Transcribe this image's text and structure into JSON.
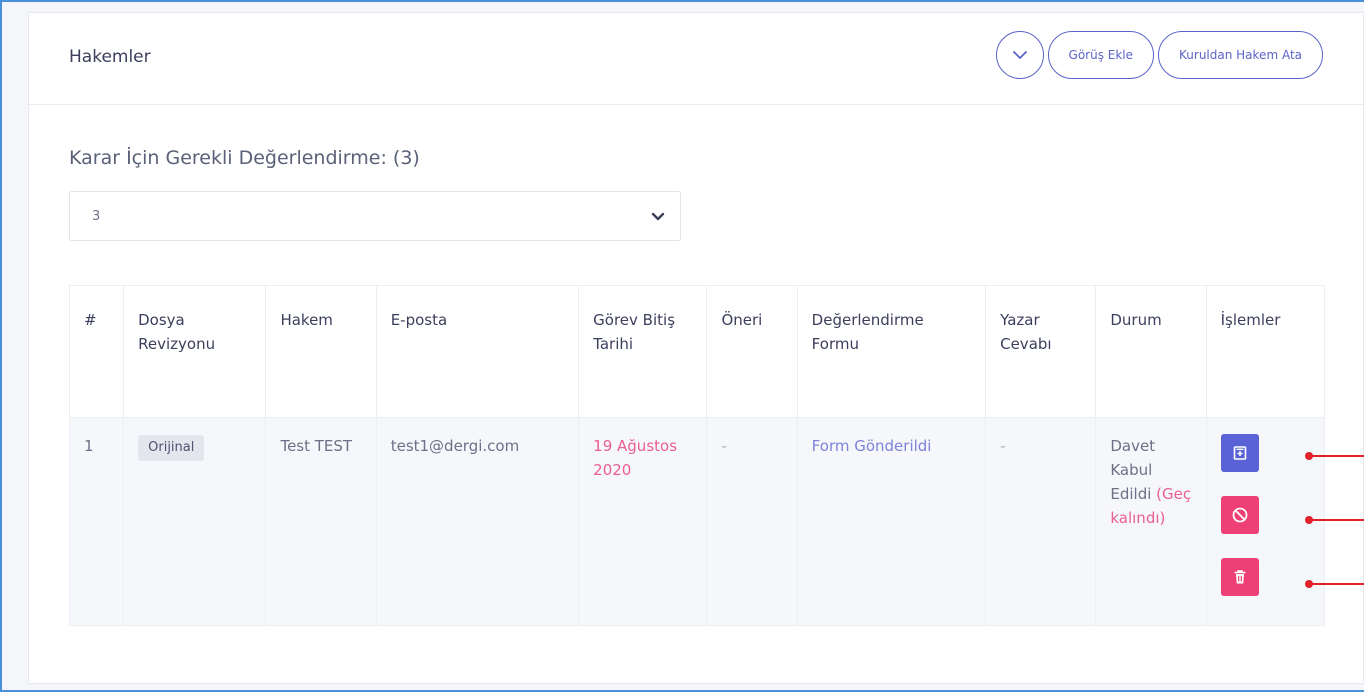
{
  "header": {
    "title": "Hakemler",
    "add_opinion": "Görüş Ekle",
    "assign_reviewer": "Kuruldan Hakem Ata"
  },
  "requirement": {
    "label": "Karar İçin Gerekli Değerlendirme: (3)",
    "selected": "3"
  },
  "table": {
    "columns": [
      "#",
      "Dosya Revizyonu",
      "Hakem",
      "E-posta",
      "Görev Bitiş Tarihi",
      "Öneri",
      "Değerlendirme Formu",
      "Yazar Cevabı",
      "Durum",
      "İşlemler"
    ],
    "rows": [
      {
        "no": "1",
        "revision": "Orijinal",
        "reviewer": "Test TEST",
        "email": "test1@dergi.com",
        "due": "19 Ağustos 2020",
        "suggestion": "-",
        "form": "Form Gönderildi",
        "author_reply": "-",
        "status": "Davet Kabul Edildi",
        "status_late": "(Geç kalındı)"
      }
    ]
  },
  "icons": {
    "toggle": "chevron-down-icon",
    "form": "form-icon",
    "cancel": "ban-icon",
    "delete": "trash-icon"
  },
  "colors": {
    "accent": "#5b64c8",
    "danger": "#ee3f76",
    "late": "#e95f8d"
  }
}
